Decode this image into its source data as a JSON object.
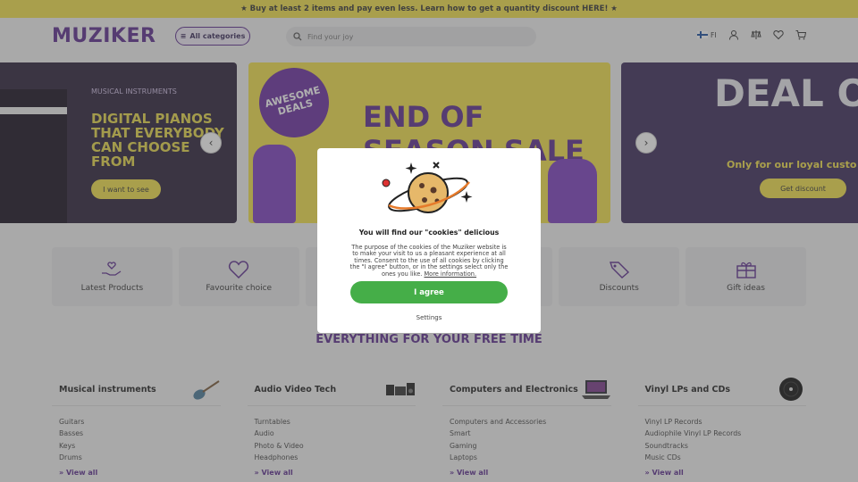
{
  "promo": {
    "text": "★ Buy at least 2 items and pay even less. Learn how to get a quantity discount HERE! ★"
  },
  "header": {
    "logo": "MUZIKER",
    "categories_label": "All categories",
    "search_placeholder": "Find your joy",
    "lang": "FI"
  },
  "banners": {
    "left": {
      "kicker": "MUSICAL INSTRUMENTS",
      "title": "DIGITAL PIANOS THAT EVERYBODY CAN CHOOSE FROM",
      "cta": "I want to see"
    },
    "center": {
      "badge": "AWESOME DEALS",
      "title": "END OF SEASON SALE"
    },
    "right": {
      "title": "DEAL OF THE MONTH",
      "subtitle": "Only for our loyal custo",
      "cta": "Get discount"
    }
  },
  "tiles": [
    {
      "label": "Latest Products",
      "icon": "hand-heart-icon"
    },
    {
      "label": "Favourite choice",
      "icon": "heart-icon"
    },
    {
      "label": "",
      "icon": ""
    },
    {
      "label": "",
      "icon": ""
    },
    {
      "label": "Discounts",
      "icon": "tag-icon"
    },
    {
      "label": "Gift ideas",
      "icon": "gift-icon"
    }
  ],
  "section_heading": "EVERYTHING FOR YOUR FREE TIME",
  "columns": [
    {
      "title": "Musical instruments",
      "links": [
        "Guitars",
        "Basses",
        "Keys",
        "Drums"
      ],
      "view_all": "View all"
    },
    {
      "title": "Audio Video Tech",
      "links": [
        "Turntables",
        "Audio",
        "Photo & Video",
        "Headphones"
      ],
      "view_all": "View all"
    },
    {
      "title": "Computers and Electronics",
      "links": [
        "Computers and Accessories",
        "Smart",
        "Gaming",
        "Laptops"
      ],
      "view_all": "View all"
    },
    {
      "title": "Vinyl LPs and CDs",
      "links": [
        "Vinyl LP Records",
        "Audiophile Vinyl LP Records",
        "Soundtracks",
        "Music CDs"
      ],
      "view_all": "View all"
    }
  ],
  "cookie_modal": {
    "title": "You will find our \"cookies\" delicious",
    "text": "The purpose of the cookies of the Muziker website is to make your visit to us a pleasant experience at all times. Consent to the use of all cookies by clicking the \"I agree\" button, or in the settings select only the ones you like.",
    "more_link": "More information.",
    "agree": "I agree",
    "settings": "Settings"
  },
  "colors": {
    "brand": "#5b2c8e",
    "accent": "#f2e14a",
    "agree": "#45ae48"
  }
}
